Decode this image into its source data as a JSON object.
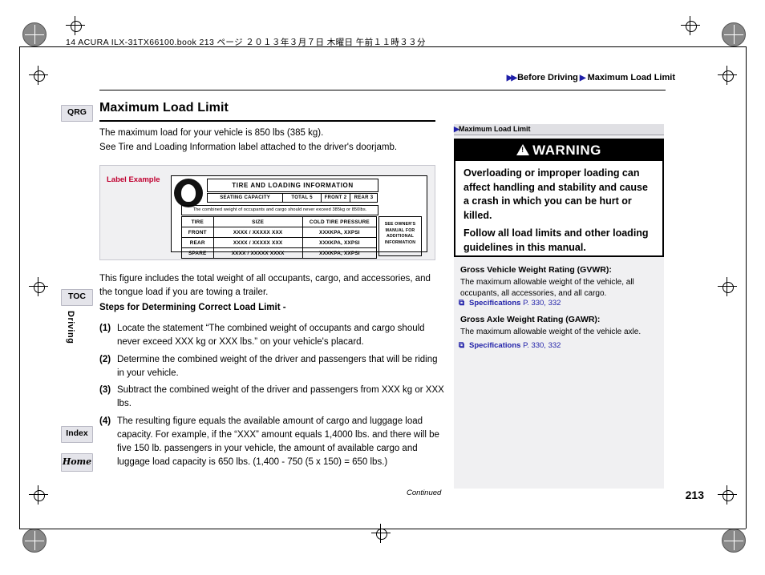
{
  "header": {
    "book_line": "14 ACURA ILX-31TX66100.book   213 ページ   ２０１３年３月７日   木曜日   午前１１時３３分",
    "breadcrumb_section": "Before Driving",
    "breadcrumb_page": "Maximum Load Limit"
  },
  "tabs": {
    "qrg": "QRG",
    "toc": "TOC",
    "index": "Index",
    "home": "Home",
    "vertical": "Driving"
  },
  "main": {
    "title": "Maximum Load Limit",
    "intro_1": "The maximum load for your vehicle is 850 lbs (385 kg).",
    "intro_2": "See Tire and Loading Information label attached to the driver's doorjamb.",
    "figure": {
      "caption": "Label Example",
      "placard_title": "TIRE  AND  LOADING  INFORMATION",
      "seating_capacity_label": "SEATING  CAPACITY",
      "total_label": "TOTAL",
      "total_value": "5",
      "front_label": "FRONT",
      "front_value": "2",
      "rear_label": "REAR",
      "rear_value": "3",
      "capacity_note": "The combined weight of occupants and cargo should never  exceed 385kg or 850lbs.",
      "table_headers": [
        "TIRE",
        "SIZE",
        "COLD TIRE PRESSURE"
      ],
      "rows": [
        {
          "tire": "FRONT",
          "size": "XXXX / XXXXX  XXX",
          "pressure": "XXXKPA, XXPSI"
        },
        {
          "tire": "REAR",
          "size": "XXXX / XXXXX  XXX",
          "pressure": "XXXKPA, XXPSI"
        },
        {
          "tire": "SPARE",
          "size": "XXXX / XXXXX  XXXX",
          "pressure": "XXXKPA, XXPSI"
        }
      ],
      "owners_note": "SEE  OWNER'S MANUAL  FOR ADDITIONAL INFORMATION"
    },
    "body_para": "This figure includes the total weight of all occupants, cargo, and accessories, and the tongue load if you are towing a trailer.",
    "steps_heading": "Steps for Determining Correct Load Limit -",
    "steps": [
      {
        "num": "(1)",
        "text": "Locate the statement “The combined weight of occupants and cargo should never exceed XXX kg or XXX lbs.” on your vehicle's placard."
      },
      {
        "num": "(2)",
        "text": "Determine the combined weight of the driver and passengers that will be riding in your vehicle."
      },
      {
        "num": "(3)",
        "text": "Subtract the combined weight of the driver and passengers from XXX kg or XXX lbs."
      },
      {
        "num": "(4)",
        "text": "The resulting figure equals the available amount of cargo and luggage load capacity. For example, if the “XXX” amount equals 1,4000 lbs. and there will be five 150 lb. passengers in your vehicle, the amount of available cargo and luggage load capacity is 650 lbs. (1,400 - 750 (5 x 150) = 650 lbs.)"
      }
    ],
    "continued": "Continued",
    "page_number": "213"
  },
  "sidebar": {
    "header": "Maximum Load Limit",
    "warning_title": "WARNING",
    "warning_p1": "Overloading or improper loading can affect handling and stability and cause a crash in which you can be hurt or killed.",
    "warning_p2": "Follow all load limits and other loading guidelines in this manual.",
    "items": [
      {
        "title": "Gross Vehicle Weight Rating (GVWR):",
        "body": "The maximum allowable weight of the vehicle, all occupants, all accessories, and all cargo.",
        "link_label": "Specifications",
        "link_pages": "P. 330, 332"
      },
      {
        "title": "Gross Axle Weight Rating (GAWR):",
        "body": "The maximum allowable weight of the vehicle axle.",
        "link_label": "Specifications",
        "link_pages": "P. 330, 332"
      }
    ]
  },
  "colors": {
    "accent_blue": "#1f1fa8",
    "label_red": "#c00030",
    "sidebar_bg": "#f0f0f2"
  }
}
